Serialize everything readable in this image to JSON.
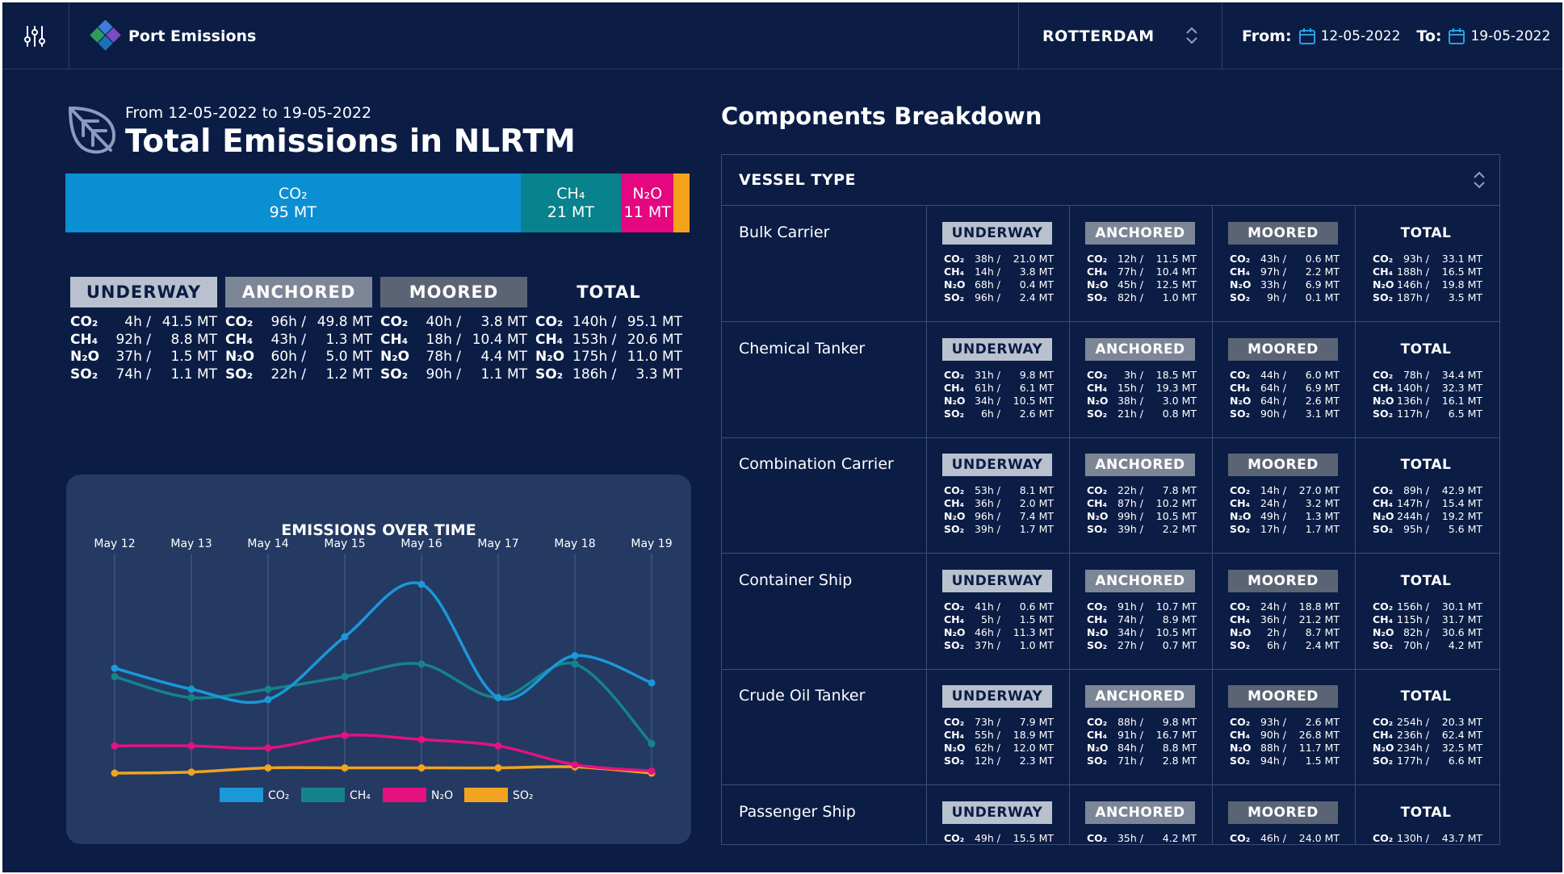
{
  "header": {
    "app_name": "Port Emissions",
    "port": "ROTTERDAM",
    "from_label": "From:",
    "from_date": "12-05-2022",
    "to_label": "To:",
    "to_date": "19-05-2022"
  },
  "summary": {
    "subtitle": "From 12-05-2022 to 19-05-2022",
    "title": "Total Emissions in NLRTM",
    "bar": [
      {
        "gas": "CO₂",
        "value": "95 MT",
        "amount": 95,
        "color": "#0a8fd3"
      },
      {
        "gas": "CH₄",
        "value": "21 MT",
        "amount": 21,
        "color": "#08828d"
      },
      {
        "gas": "N₂O",
        "value": "11 MT",
        "amount": 11,
        "color": "#e5077f"
      },
      {
        "gas": "",
        "value": "",
        "amount": 3.3,
        "color": "#f4a21a"
      }
    ]
  },
  "status_totals": [
    {
      "label": "UNDERWAY",
      "rows": [
        {
          "gas": "CO₂",
          "h": "4h /",
          "mt": "41.5 MT"
        },
        {
          "gas": "CH₄",
          "h": "92h /",
          "mt": "8.8 MT"
        },
        {
          "gas": "N₂O",
          "h": "37h /",
          "mt": "1.5 MT"
        },
        {
          "gas": "SO₂",
          "h": "74h /",
          "mt": "1.1 MT"
        }
      ]
    },
    {
      "label": "ANCHORED",
      "rows": [
        {
          "gas": "CO₂",
          "h": "96h /",
          "mt": "49.8 MT"
        },
        {
          "gas": "CH₄",
          "h": "43h /",
          "mt": "1.3 MT"
        },
        {
          "gas": "N₂O",
          "h": "60h /",
          "mt": "5.0 MT"
        },
        {
          "gas": "SO₂",
          "h": "22h /",
          "mt": "1.2 MT"
        }
      ]
    },
    {
      "label": "MOORED",
      "rows": [
        {
          "gas": "CO₂",
          "h": "40h /",
          "mt": "3.8 MT"
        },
        {
          "gas": "CH₄",
          "h": "18h /",
          "mt": "10.4 MT"
        },
        {
          "gas": "N₂O",
          "h": "78h /",
          "mt": "4.4 MT"
        },
        {
          "gas": "SO₂",
          "h": "90h /",
          "mt": "1.1 MT"
        }
      ]
    },
    {
      "label": "TOTAL",
      "rows": [
        {
          "gas": "CO₂",
          "h": "140h /",
          "mt": "95.1 MT"
        },
        {
          "gas": "CH₄",
          "h": "153h /",
          "mt": "20.6 MT"
        },
        {
          "gas": "N₂O",
          "h": "175h /",
          "mt": "11.0 MT"
        },
        {
          "gas": "SO₂",
          "h": "186h /",
          "mt": "3.3 MT"
        }
      ]
    }
  ],
  "chart_data": {
    "type": "line",
    "title": "EMISSIONS OVER TIME",
    "categories": [
      "May 12",
      "May 13",
      "May 14",
      "May 15",
      "May 16",
      "May 17",
      "May 18",
      "May 19"
    ],
    "ylim": [
      0,
      100
    ],
    "grid": "vertical",
    "legend_position": "bottom",
    "series": [
      {
        "name": "CO₂",
        "color": "#1a98d8",
        "values": [
          50,
          40,
          35,
          65,
          90,
          36,
          56,
          43
        ]
      },
      {
        "name": "CH₄",
        "color": "#15838c",
        "values": [
          46,
          36,
          40,
          46,
          52,
          36,
          52,
          14
        ]
      },
      {
        "name": "N₂O",
        "color": "#e3127f",
        "values": [
          13,
          13,
          12,
          18,
          16,
          13,
          4,
          1
        ]
      },
      {
        "name": "SO₂",
        "color": "#f2a420",
        "values": [
          0,
          0.5,
          2.5,
          2.5,
          2.5,
          2.5,
          3,
          0
        ]
      }
    ]
  },
  "components": {
    "title": "Components Breakdown",
    "vessel_type_label": "VESSEL TYPE",
    "vessels": [
      {
        "name": "Bulk Carrier",
        "cells": [
          {
            "label": "UNDERWAY",
            "rows": [
              [
                "CO₂",
                "38h /",
                "21.0 MT"
              ],
              [
                "CH₄",
                "14h /",
                "3.8 MT"
              ],
              [
                "N₂O",
                "68h /",
                "0.4 MT"
              ],
              [
                "SO₂",
                "96h /",
                "2.4 MT"
              ]
            ]
          },
          {
            "label": "ANCHORED",
            "rows": [
              [
                "CO₂",
                "12h /",
                "11.5 MT"
              ],
              [
                "CH₄",
                "77h /",
                "10.4 MT"
              ],
              [
                "N₂O",
                "45h /",
                "12.5 MT"
              ],
              [
                "SO₂",
                "82h /",
                "1.0 MT"
              ]
            ]
          },
          {
            "label": "MOORED",
            "rows": [
              [
                "CO₂",
                "43h /",
                "0.6 MT"
              ],
              [
                "CH₄",
                "97h /",
                "2.2 MT"
              ],
              [
                "N₂O",
                "33h /",
                "6.9 MT"
              ],
              [
                "SO₂",
                "9h /",
                "0.1 MT"
              ]
            ]
          },
          {
            "label": "TOTAL",
            "rows": [
              [
                "CO₂",
                "93h /",
                "33.1 MT"
              ],
              [
                "CH₄",
                "188h /",
                "16.5 MT"
              ],
              [
                "N₂O",
                "146h /",
                "19.8 MT"
              ],
              [
                "SO₂",
                "187h /",
                "3.5 MT"
              ]
            ]
          }
        ]
      },
      {
        "name": "Chemical Tanker",
        "cells": [
          {
            "label": "UNDERWAY",
            "rows": [
              [
                "CO₂",
                "31h /",
                "9.8 MT"
              ],
              [
                "CH₄",
                "61h /",
                "6.1 MT"
              ],
              [
                "N₂O",
                "34h /",
                "10.5 MT"
              ],
              [
                "SO₂",
                "6h /",
                "2.6 MT"
              ]
            ]
          },
          {
            "label": "ANCHORED",
            "rows": [
              [
                "CO₂",
                "3h /",
                "18.5 MT"
              ],
              [
                "CH₄",
                "15h /",
                "19.3 MT"
              ],
              [
                "N₂O",
                "38h /",
                "3.0 MT"
              ],
              [
                "SO₂",
                "21h /",
                "0.8 MT"
              ]
            ]
          },
          {
            "label": "MOORED",
            "rows": [
              [
                "CO₂",
                "44h /",
                "6.0 MT"
              ],
              [
                "CH₄",
                "64h /",
                "6.9 MT"
              ],
              [
                "N₂O",
                "64h /",
                "2.6 MT"
              ],
              [
                "SO₂",
                "90h /",
                "3.1 MT"
              ]
            ]
          },
          {
            "label": "TOTAL",
            "rows": [
              [
                "CO₂",
                "78h /",
                "34.4 MT"
              ],
              [
                "CH₄",
                "140h /",
                "32.3 MT"
              ],
              [
                "N₂O",
                "136h /",
                "16.1 MT"
              ],
              [
                "SO₂",
                "117h /",
                "6.5 MT"
              ]
            ]
          }
        ]
      },
      {
        "name": "Combination Carrier",
        "cells": [
          {
            "label": "UNDERWAY",
            "rows": [
              [
                "CO₂",
                "53h /",
                "8.1 MT"
              ],
              [
                "CH₄",
                "36h /",
                "2.0 MT"
              ],
              [
                "N₂O",
                "96h /",
                "7.4 MT"
              ],
              [
                "SO₂",
                "39h /",
                "1.7 MT"
              ]
            ]
          },
          {
            "label": "ANCHORED",
            "rows": [
              [
                "CO₂",
                "22h /",
                "7.8 MT"
              ],
              [
                "CH₄",
                "87h /",
                "10.2 MT"
              ],
              [
                "N₂O",
                "99h /",
                "10.5 MT"
              ],
              [
                "SO₂",
                "39h /",
                "2.2 MT"
              ]
            ]
          },
          {
            "label": "MOORED",
            "rows": [
              [
                "CO₂",
                "14h /",
                "27.0 MT"
              ],
              [
                "CH₄",
                "24h /",
                "3.2 MT"
              ],
              [
                "N₂O",
                "49h /",
                "1.3 MT"
              ],
              [
                "SO₂",
                "17h /",
                "1.7 MT"
              ]
            ]
          },
          {
            "label": "TOTAL",
            "rows": [
              [
                "CO₂",
                "89h /",
                "42.9 MT"
              ],
              [
                "CH₄",
                "147h /",
                "15.4 MT"
              ],
              [
                "N₂O",
                "244h /",
                "19.2 MT"
              ],
              [
                "SO₂",
                "95h /",
                "5.6 MT"
              ]
            ]
          }
        ]
      },
      {
        "name": "Container Ship",
        "cells": [
          {
            "label": "UNDERWAY",
            "rows": [
              [
                "CO₂",
                "41h /",
                "0.6 MT"
              ],
              [
                "CH₄",
                "5h /",
                "1.5 MT"
              ],
              [
                "N₂O",
                "46h /",
                "11.3 MT"
              ],
              [
                "SO₂",
                "37h /",
                "1.0 MT"
              ]
            ]
          },
          {
            "label": "ANCHORED",
            "rows": [
              [
                "CO₂",
                "91h /",
                "10.7 MT"
              ],
              [
                "CH₄",
                "74h /",
                "8.9 MT"
              ],
              [
                "N₂O",
                "34h /",
                "10.5 MT"
              ],
              [
                "SO₂",
                "27h /",
                "0.7 MT"
              ]
            ]
          },
          {
            "label": "MOORED",
            "rows": [
              [
                "CO₂",
                "24h /",
                "18.8 MT"
              ],
              [
                "CH₄",
                "36h /",
                "21.2 MT"
              ],
              [
                "N₂O",
                "2h /",
                "8.7 MT"
              ],
              [
                "SO₂",
                "6h /",
                "2.4 MT"
              ]
            ]
          },
          {
            "label": "TOTAL",
            "rows": [
              [
                "CO₂",
                "156h /",
                "30.1 MT"
              ],
              [
                "CH₄",
                "115h /",
                "31.7 MT"
              ],
              [
                "N₂O",
                "82h /",
                "30.6 MT"
              ],
              [
                "SO₂",
                "70h /",
                "4.2 MT"
              ]
            ]
          }
        ]
      },
      {
        "name": "Crude Oil Tanker",
        "cells": [
          {
            "label": "UNDERWAY",
            "rows": [
              [
                "CO₂",
                "73h /",
                "7.9 MT"
              ],
              [
                "CH₄",
                "55h /",
                "18.9 MT"
              ],
              [
                "N₂O",
                "62h /",
                "12.0 MT"
              ],
              [
                "SO₂",
                "12h /",
                "2.3 MT"
              ]
            ]
          },
          {
            "label": "ANCHORED",
            "rows": [
              [
                "CO₂",
                "88h /",
                "9.8 MT"
              ],
              [
                "CH₄",
                "91h /",
                "16.7 MT"
              ],
              [
                "N₂O",
                "84h /",
                "8.8 MT"
              ],
              [
                "SO₂",
                "71h /",
                "2.8 MT"
              ]
            ]
          },
          {
            "label": "MOORED",
            "rows": [
              [
                "CO₂",
                "93h /",
                "2.6 MT"
              ],
              [
                "CH₄",
                "90h /",
                "26.8 MT"
              ],
              [
                "N₂O",
                "88h /",
                "11.7 MT"
              ],
              [
                "SO₂",
                "94h /",
                "1.5 MT"
              ]
            ]
          },
          {
            "label": "TOTAL",
            "rows": [
              [
                "CO₂",
                "254h /",
                "20.3 MT"
              ],
              [
                "CH₄",
                "236h /",
                "62.4 MT"
              ],
              [
                "N₂O",
                "234h /",
                "32.5 MT"
              ],
              [
                "SO₂",
                "177h /",
                "6.6 MT"
              ]
            ]
          }
        ]
      },
      {
        "name": "Passenger Ship",
        "cells": [
          {
            "label": "UNDERWAY",
            "rows": [
              [
                "CO₂",
                "49h /",
                "15.5 MT"
              ]
            ]
          },
          {
            "label": "ANCHORED",
            "rows": [
              [
                "CO₂",
                "35h /",
                "4.2 MT"
              ]
            ]
          },
          {
            "label": "MOORED",
            "rows": [
              [
                "CO₂",
                "46h /",
                "24.0 MT"
              ]
            ]
          },
          {
            "label": "TOTAL",
            "rows": [
              [
                "CO₂",
                "130h /",
                "43.7 MT"
              ]
            ]
          }
        ]
      }
    ]
  }
}
